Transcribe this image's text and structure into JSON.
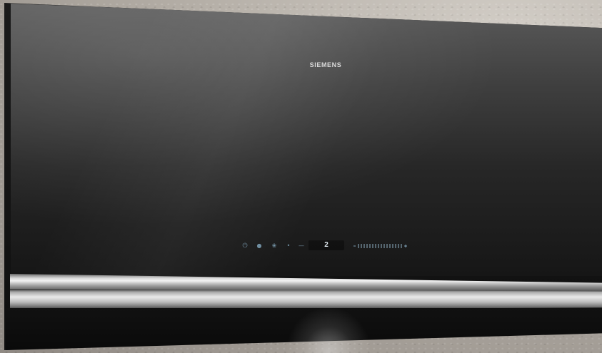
{
  "brand": "SIEMENS",
  "controls": {
    "power_icon": "power-icon",
    "sensor_icon": "air-sensor-icon",
    "fan_icon": "fan-icon",
    "light_icon": "light-icon",
    "minus_icon": "minus-icon",
    "level_value": "2",
    "slider_icon": "touch-slider-icon"
  },
  "colors": {
    "glass": "#2a2a2a",
    "control_glow": "#7fa2b8",
    "steel": "#d9d9d9"
  }
}
